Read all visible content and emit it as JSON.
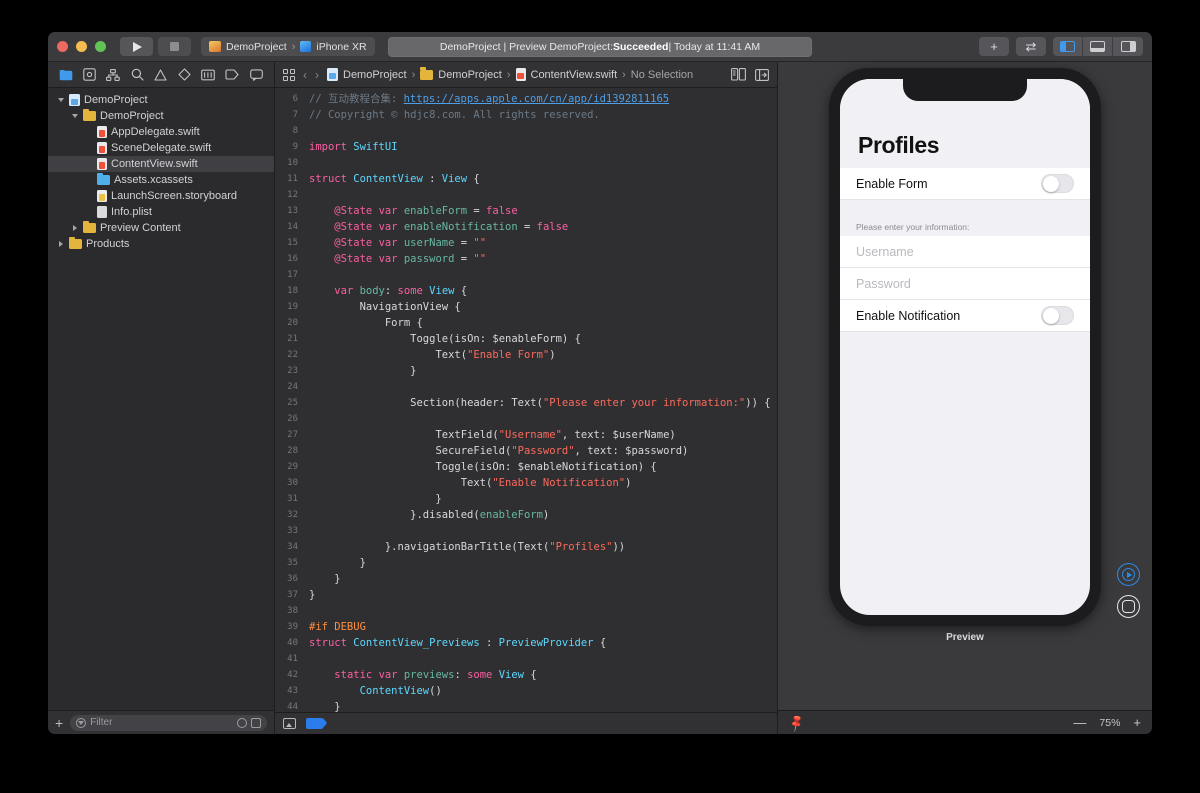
{
  "window": {
    "traffic_lights": [
      "close",
      "minimize",
      "zoom"
    ],
    "run_button": "run",
    "stop_button": "stop",
    "scheme": {
      "target": "DemoProject",
      "separator": "›",
      "device": "iPhone XR"
    },
    "status": {
      "prefix": "DemoProject | Preview DemoProject: ",
      "result": "Succeeded",
      "suffix": " | Today at 11:41 AM"
    },
    "right_buttons": {
      "add": "+",
      "swap": "⇄"
    },
    "panel_toggles": [
      "navigator-panel",
      "debug-panel",
      "inspector-panel"
    ]
  },
  "navigator": {
    "icons": [
      "folder-icon",
      "source-control-icon",
      "symbol-hierarchy-icon",
      "find-icon",
      "warning-icon",
      "breakpoint-icon",
      "report-icon",
      "tag-icon",
      "comment-icon"
    ],
    "tree": [
      {
        "label": "DemoProject",
        "indent": 0,
        "icon": "project-icon",
        "disclosure": "open",
        "selected": false
      },
      {
        "label": "DemoProject",
        "indent": 1,
        "icon": "folder-icon",
        "disclosure": "open",
        "selected": false
      },
      {
        "label": "AppDelegate.swift",
        "indent": 2,
        "icon": "swift-file-icon",
        "disclosure": "none",
        "selected": false
      },
      {
        "label": "SceneDelegate.swift",
        "indent": 2,
        "icon": "swift-file-icon",
        "disclosure": "none",
        "selected": false
      },
      {
        "label": "ContentView.swift",
        "indent": 2,
        "icon": "swift-file-icon",
        "disclosure": "none",
        "selected": true
      },
      {
        "label": "Assets.xcassets",
        "indent": 2,
        "icon": "assets-icon",
        "disclosure": "none",
        "selected": false
      },
      {
        "label": "LaunchScreen.storyboard",
        "indent": 2,
        "icon": "storyboard-icon",
        "disclosure": "none",
        "selected": false
      },
      {
        "label": "Info.plist",
        "indent": 2,
        "icon": "plist-icon",
        "disclosure": "none",
        "selected": false
      },
      {
        "label": "Preview Content",
        "indent": 1,
        "icon": "folder-icon",
        "disclosure": "closed",
        "selected": false
      },
      {
        "label": "Products",
        "indent": 0,
        "icon": "folder-icon",
        "disclosure": "closed",
        "selected": false
      }
    ],
    "bottom": {
      "add_label": "+",
      "filter_placeholder": "Filter"
    }
  },
  "editor": {
    "breadcrumb": [
      "DemoProject",
      "DemoProject",
      "ContentView.swift",
      "No Selection"
    ],
    "first_line_number": 6,
    "lines": [
      "// 互动教程合集: https://apps.apple.com/cn/app/id1392811165",
      "// Copyright © hdjc8.com. All rights reserved.",
      "",
      "import SwiftUI",
      "",
      "struct ContentView : View {",
      "",
      "    @State var enableForm = false",
      "    @State var enableNotification = false",
      "    @State var userName = \"\"",
      "    @State var password = \"\"",
      "",
      "    var body: some View {",
      "        NavigationView {",
      "            Form {",
      "                Toggle(isOn: $enableForm) {",
      "                    Text(\"Enable Form\")",
      "                }",
      "",
      "                Section(header: Text(\"Please enter your information:\")) {",
      "",
      "                    TextField(\"Username\", text: $userName)",
      "                    SecureField(\"Password\", text: $password)",
      "                    Toggle(isOn: $enableNotification) {",
      "                        Text(\"Enable Notification\")",
      "                    }",
      "                }.disabled(enableForm)",
      "",
      "            }.navigationBarTitle(Text(\"Profiles\"))",
      "        }",
      "    }",
      "}",
      "",
      "#if DEBUG",
      "struct ContentView_Previews : PreviewProvider {",
      "",
      "    static var previews: some View {",
      "        ContentView()",
      "    }",
      "}"
    ]
  },
  "preview": {
    "device": "iPhone XR",
    "nav_title": "Profiles",
    "rows": [
      {
        "type": "toggle",
        "label": "Enable Form",
        "value": "off"
      },
      {
        "type": "section-header",
        "label": "Please enter your information:"
      },
      {
        "type": "textfield",
        "placeholder": "Username"
      },
      {
        "type": "securefield",
        "placeholder": "Password"
      },
      {
        "type": "toggle",
        "label": "Enable Notification",
        "value": "off"
      }
    ],
    "caption": "Preview",
    "live_button": "live-preview-play",
    "device_button": "preview-on-device",
    "bottom": {
      "pin": "pin-icon",
      "zoom_out": "—",
      "zoom_level": "75%",
      "zoom_in": "+"
    }
  },
  "colors": {
    "accent_blue": "#3f9aec",
    "keyword_pink": "#fc5fa3",
    "type_cyan": "#5dd8ff",
    "string_red": "#fc6a5d",
    "comment_gray": "#6c7986",
    "directive_orange": "#fd8f3f",
    "toolbar_bg": "#3b3b3e",
    "editor_bg": "#2f2f31",
    "canvas_bg": "#3a3a3c"
  }
}
